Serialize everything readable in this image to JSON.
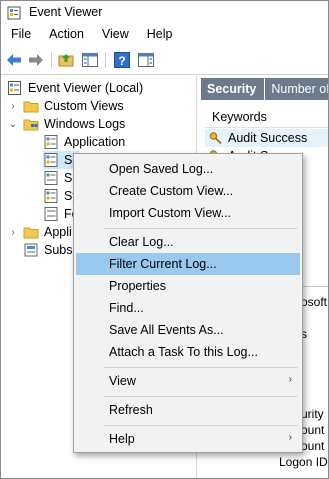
{
  "window": {
    "title": "Event Viewer"
  },
  "menubar": {
    "items": [
      "File",
      "Action",
      "View",
      "Help"
    ]
  },
  "toolbar": {
    "buttons": [
      "back-arrow-icon",
      "forward-arrow-icon",
      "folder-up-icon",
      "show-hide-tree-icon",
      "help-icon",
      "action-pane-icon"
    ]
  },
  "tree": {
    "root": "Event Viewer (Local)",
    "custom_views": "Custom Views",
    "windows_logs": "Windows Logs",
    "application": "Application",
    "security_partial": "Se",
    "setup_partial": "Se",
    "system_partial": "Sy",
    "forwarded_partial": "Fo",
    "apps_services_partial": "Appli",
    "subscriptions_partial": "Subsc"
  },
  "right_pane": {
    "header_title": "Security",
    "header_count": "Number of",
    "column_keywords": "Keywords",
    "row1": "Audit Success",
    "row2_partial": "Audit S",
    "frag_source": "osoft W",
    "frag_tab": "s",
    "frag_security": "urity II",
    "frag_account1": "ount I",
    "frag_account2": "ount I",
    "frag_logon": "Logon ID:"
  },
  "context_menu": {
    "items": [
      {
        "label": "Open Saved Log...",
        "submenu": false
      },
      {
        "label": "Create Custom View...",
        "submenu": false
      },
      {
        "label": "Import Custom View...",
        "submenu": false
      },
      {
        "label": "Clear Log...",
        "submenu": false
      },
      {
        "label": "Filter Current Log...",
        "submenu": false,
        "highlighted": true
      },
      {
        "label": "Properties",
        "submenu": false
      },
      {
        "label": "Find...",
        "submenu": false
      },
      {
        "label": "Save All Events As...",
        "submenu": false
      },
      {
        "label": "Attach a Task To this Log...",
        "submenu": false
      },
      {
        "label": "View",
        "submenu": true
      },
      {
        "label": "Refresh",
        "submenu": false
      },
      {
        "label": "Help",
        "submenu": true
      }
    ],
    "submenu_arrow": "›"
  },
  "colors": {
    "header_bg": "#6c7a8c",
    "highlight": "#99c9ef",
    "menu_bg": "#f2f2f2",
    "selected_row": "#e5f1fb"
  }
}
